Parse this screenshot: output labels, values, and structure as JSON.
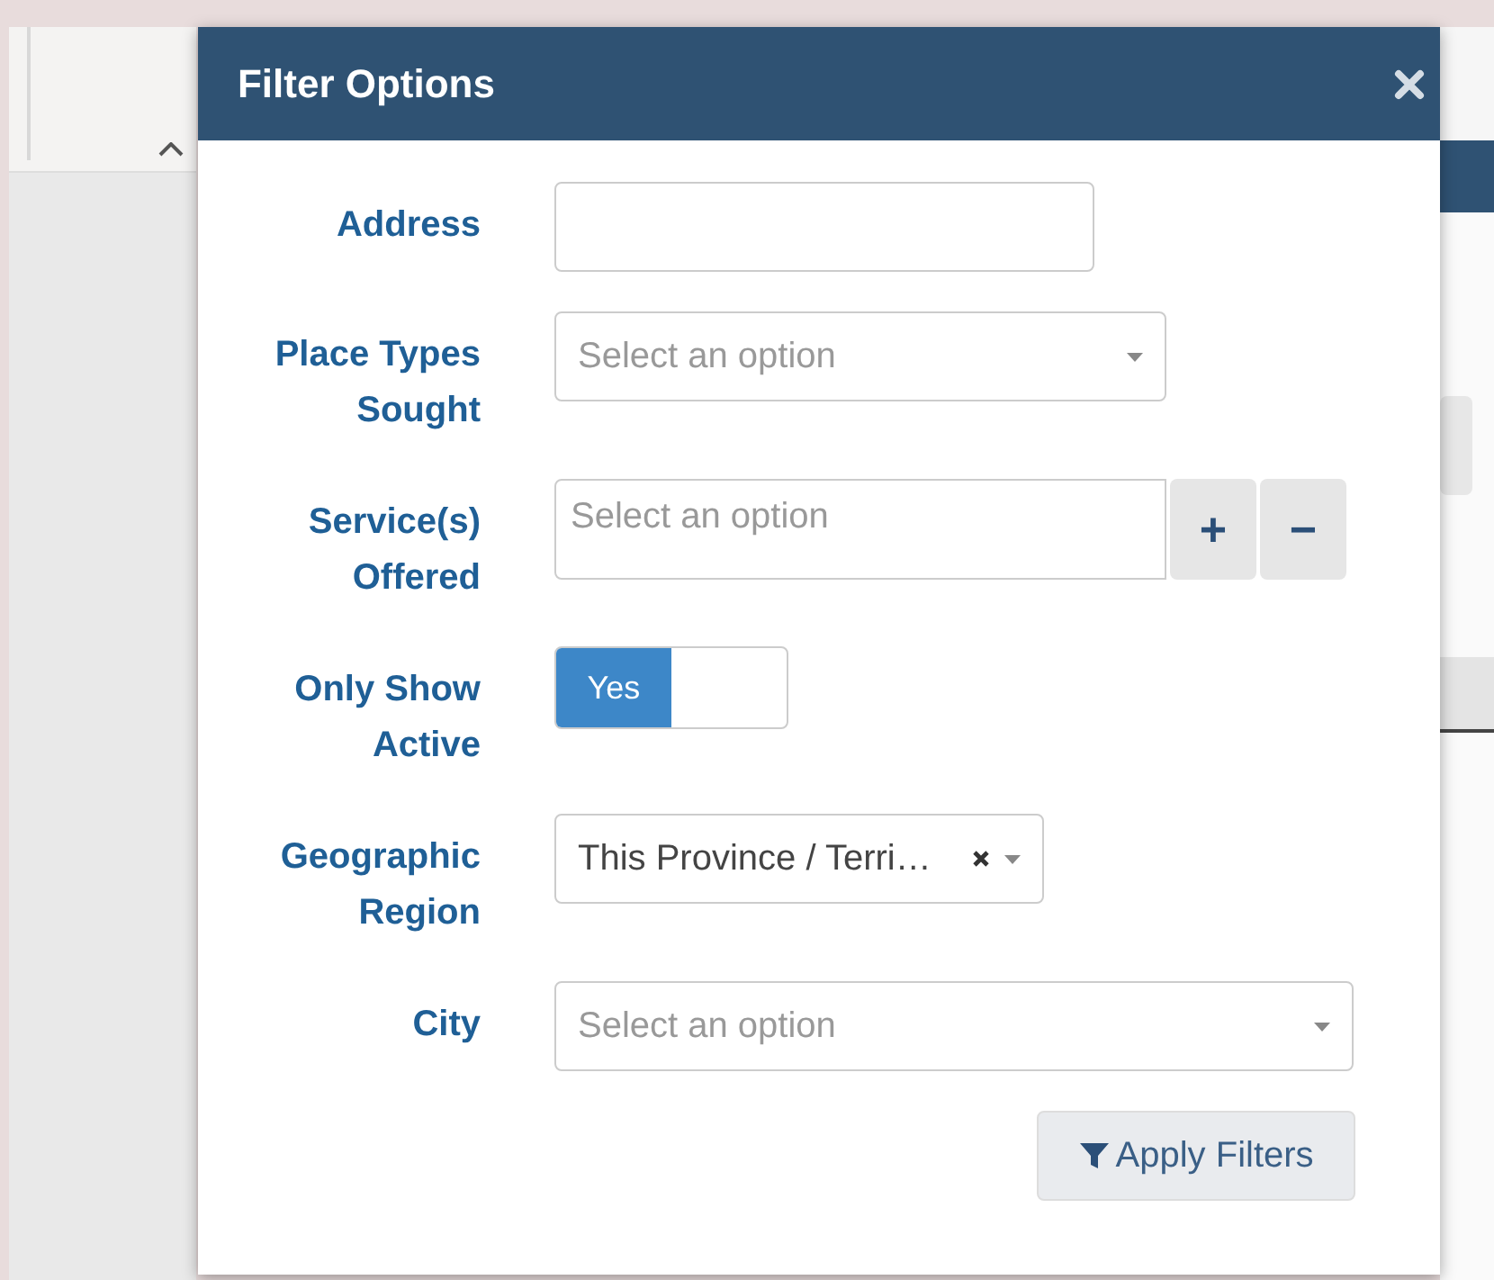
{
  "dialog": {
    "title": "Filter Options"
  },
  "fields": [
    {
      "kind": "text",
      "label": "Address"
    },
    {
      "kind": "select",
      "label": "Place Types Sought",
      "placeholder": "Select an option"
    },
    {
      "kind": "multi",
      "label": "Service(s) Offered",
      "placeholder": "Select an option",
      "buttons": [
        "+",
        "−"
      ]
    },
    {
      "kind": "toggle",
      "label": "Only Show Active",
      "on": true,
      "on_label": "Yes"
    },
    {
      "kind": "select",
      "label": "Geographic Region",
      "value": "This Province / Terri…",
      "clearable": true
    },
    {
      "kind": "select",
      "label": "City",
      "placeholder": "Select an option"
    }
  ],
  "apply_button": {
    "label": "Apply Filters"
  }
}
